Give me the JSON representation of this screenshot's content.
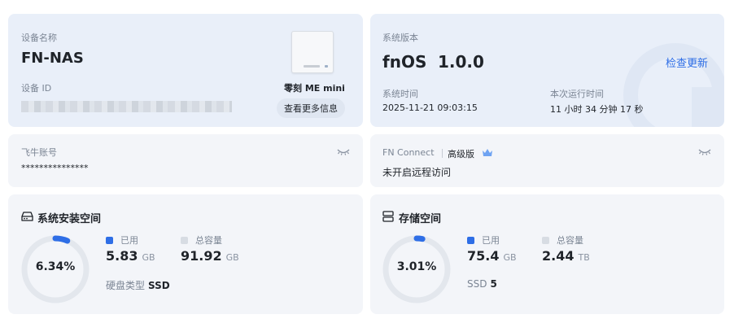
{
  "device_card": {
    "name_label": "设备名称",
    "name": "FN-NAS",
    "id_label": "设备 ID",
    "id_value": "",
    "model": "零刻 ME mini",
    "more_button": "查看更多信息"
  },
  "version_card": {
    "version_label": "系统版本",
    "version_name": "fnOS",
    "version_number": "1.0.0",
    "check_update": "检查更新",
    "time_label": "系统时间",
    "time_value": "2025-11-21 09:03:15",
    "uptime_label": "本次运行时间",
    "uptime_value": "11 小时 34 分钟 17 秒"
  },
  "account_card": {
    "label": "飞牛账号",
    "value": "***************",
    "reveal_icon": "eye-closed-icon"
  },
  "connect_card": {
    "label": "FN Connect",
    "tier": "高级版",
    "tier_icon": "crown-icon",
    "status": "未开启远程访问",
    "reveal_icon": "eye-closed-icon"
  },
  "system_space": {
    "title": "系统安装空间",
    "icon": "hard-drive-icon",
    "percent_text": "6.34%",
    "percent": 6.34,
    "used_label": "已用",
    "used_value": "5.83",
    "used_unit": "GB",
    "total_label": "总容量",
    "total_value": "91.92",
    "total_unit": "GB",
    "disk_type_label": "硬盘类型",
    "disk_type": "SSD"
  },
  "storage_space": {
    "title": "存储空间",
    "icon": "storage-icon",
    "percent_text": "3.01%",
    "percent": 3.01,
    "used_label": "已用",
    "used_value": "75.4",
    "used_unit": "GB",
    "total_label": "总容量",
    "total_value": "2.44",
    "total_unit": "TB",
    "ssd_label": "SSD",
    "ssd_count": "5"
  },
  "colors": {
    "accent": "#2e6ee6",
    "ring_track": "#e3e7ed",
    "legend_total": "#d7dce3"
  }
}
